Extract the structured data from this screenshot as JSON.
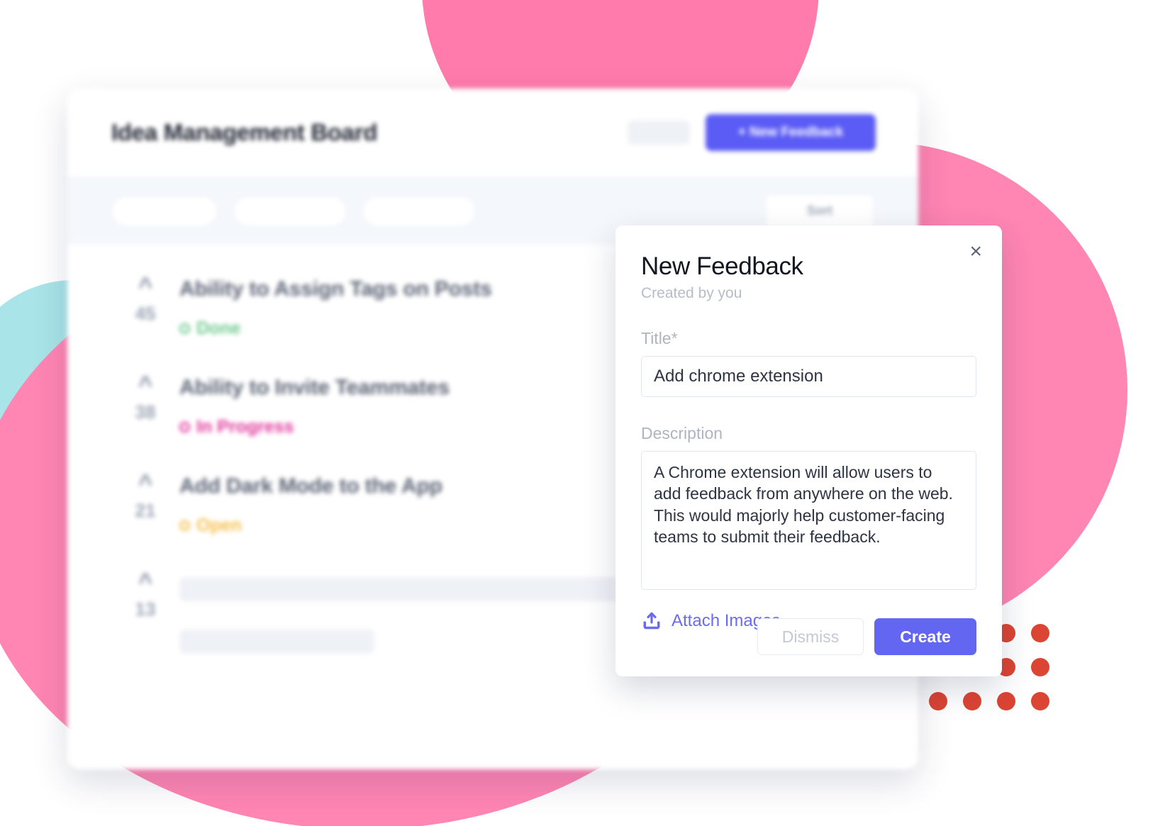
{
  "app_window": {
    "header": {
      "board_title": "Idea Management Board",
      "new_feedback_button": "+ New Feedback"
    },
    "filter_bar": {
      "sort_label": "Sort"
    },
    "items": [
      {
        "votes": "45",
        "title": "Ability to Assign Tags on Posts",
        "status": "Done",
        "status_color": "#6DC88E"
      },
      {
        "votes": "38",
        "title": "Ability to Invite Teammates",
        "status": "In Progress",
        "status_color": "#E0379B"
      },
      {
        "votes": "21",
        "title": "Add Dark Mode to the App",
        "status": "Open",
        "status_color": "#F5BE4C"
      },
      {
        "votes": "13",
        "title": "",
        "status": "",
        "status_color": "#eef1f6"
      }
    ]
  },
  "modal": {
    "title": "New Feedback",
    "subtitle": "Created by you",
    "close_label": "×",
    "title_field": {
      "label": "Title*",
      "value": "Add chrome extension"
    },
    "description_field": {
      "label": "Description",
      "value": "A Chrome extension will allow users to add feedback from anywhere on the web. This would majorly help customer-facing teams to submit their feedback."
    },
    "attach_label": "Attach Images",
    "dismiss_button": "Dismiss",
    "create_button": "Create"
  },
  "colors": {
    "accent_indigo": "#6366F1",
    "button_indigo": "#5B5BF5",
    "pink_blob": "#FF85B3",
    "cyan_blob": "#A8E4E8",
    "dot_red": "#DC4433"
  }
}
